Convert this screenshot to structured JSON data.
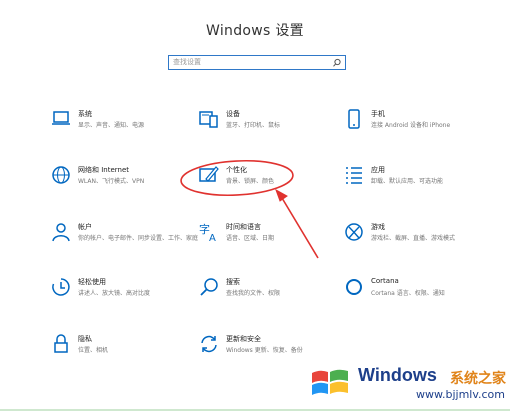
{
  "window": {
    "title": "Windows 设置"
  },
  "search": {
    "placeholder": "查找设置"
  },
  "items": [
    {
      "name": "系统",
      "desc": "显示、声音、通知、电源",
      "icon": "laptop-icon"
    },
    {
      "name": "设备",
      "desc": "蓝牙、打印机、鼠标",
      "icon": "devices-icon"
    },
    {
      "name": "手机",
      "desc": "连接 Android 设备和 iPhone",
      "icon": "phone-icon"
    },
    {
      "name": "网络和 Internet",
      "desc": "WLAN、飞行模式、VPN",
      "icon": "globe-icon"
    },
    {
      "name": "个性化",
      "desc": "背景、锁屏、颜色",
      "icon": "personalization-icon"
    },
    {
      "name": "应用",
      "desc": "卸载、默认应用、可选功能",
      "icon": "apps-list-icon"
    },
    {
      "name": "帐户",
      "desc": "你的帐户、电子邮件、同步设置、工作、家庭",
      "icon": "person-icon"
    },
    {
      "name": "时间和语言",
      "desc": "语音、区域、日期",
      "icon": "time-language-icon"
    },
    {
      "name": "游戏",
      "desc": "游戏栏、截屏、直播、游戏模式",
      "icon": "xbox-icon"
    },
    {
      "name": "轻松使用",
      "desc": "讲述人、放大镜、高对比度",
      "icon": "ease-of-access-icon"
    },
    {
      "name": "搜索",
      "desc": "查找我的文件、权限",
      "icon": "search-icon"
    },
    {
      "name": "Cortana",
      "desc": "Cortana 语言、权限、通知",
      "icon": "cortana-icon"
    },
    {
      "name": "隐私",
      "desc": "位置、相机",
      "icon": "lock-icon"
    },
    {
      "name": "更新和安全",
      "desc": "Windows 更新、恢复、备份",
      "icon": "update-icon"
    }
  ],
  "watermark": {
    "brand": "Windows",
    "cn": "系统之家",
    "url": "www.bjjmlv.com"
  },
  "colors": {
    "accent": "#0067c0",
    "annotation": "#e0322f",
    "watermark_blue": "#1d3f8a",
    "watermark_orange": "#e0841a"
  }
}
